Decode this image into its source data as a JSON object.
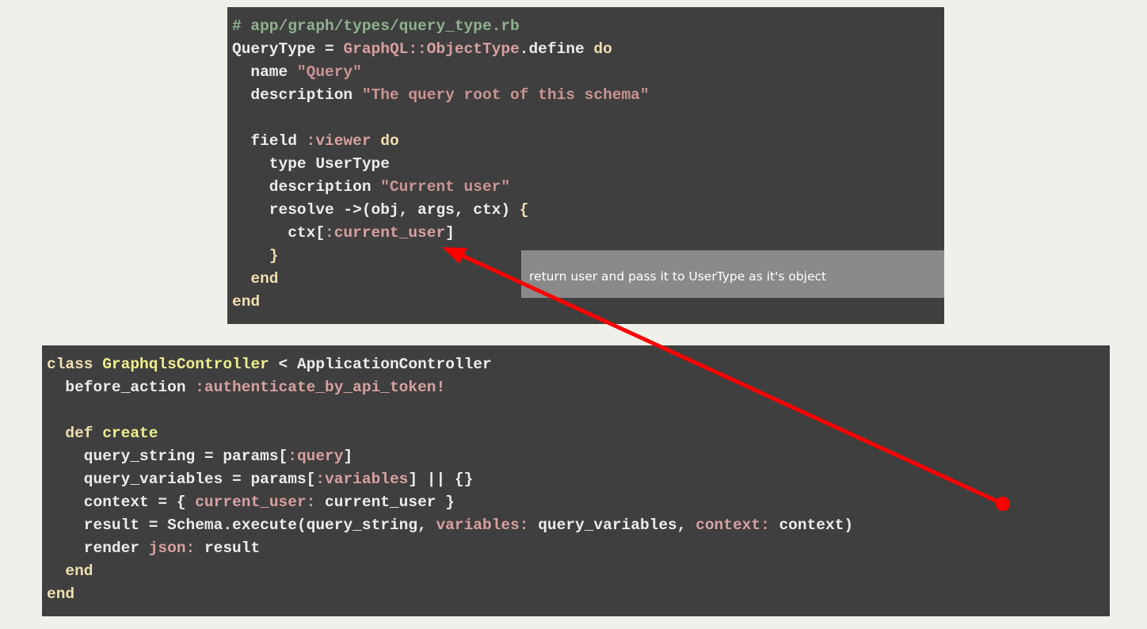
{
  "top_code": {
    "lines": [
      [
        {
          "t": "# app/graph/types/query_type.rb",
          "c": "cm"
        }
      ],
      [
        {
          "t": "QueryType = ",
          "c": ""
        },
        {
          "t": "GraphQL::ObjectType",
          "c": "sy"
        },
        {
          "t": ".define ",
          "c": ""
        },
        {
          "t": "do",
          "c": "kw"
        }
      ],
      [
        {
          "t": "  name ",
          "c": ""
        },
        {
          "t": "\"Query\"",
          "c": "st"
        }
      ],
      [
        {
          "t": "  description ",
          "c": ""
        },
        {
          "t": "\"The query root of this schema\"",
          "c": "st"
        }
      ],
      [
        {
          "t": "",
          "c": ""
        }
      ],
      [
        {
          "t": "  field ",
          "c": ""
        },
        {
          "t": ":viewer",
          "c": "sy"
        },
        {
          "t": " ",
          "c": ""
        },
        {
          "t": "do",
          "c": "kw"
        }
      ],
      [
        {
          "t": "    type UserType",
          "c": ""
        }
      ],
      [
        {
          "t": "    description ",
          "c": ""
        },
        {
          "t": "\"Current user\"",
          "c": "st"
        }
      ],
      [
        {
          "t": "    resolve ->(obj, args, ctx) ",
          "c": ""
        },
        {
          "t": "{",
          "c": "kw"
        }
      ],
      [
        {
          "t": "      ctx[",
          "c": ""
        },
        {
          "t": ":current_user",
          "c": "sy"
        },
        {
          "t": "]",
          "c": ""
        }
      ],
      [
        {
          "t": "    }",
          "c": "kw"
        }
      ],
      [
        {
          "t": "  end",
          "c": "kw"
        }
      ],
      [
        {
          "t": "end",
          "c": "kw"
        }
      ]
    ]
  },
  "bottom_code": {
    "lines": [
      [
        {
          "t": "class ",
          "c": "kw"
        },
        {
          "t": "GraphqlsController",
          "c": "cn"
        },
        {
          "t": " < ApplicationController",
          "c": ""
        }
      ],
      [
        {
          "t": "  before_action ",
          "c": ""
        },
        {
          "t": ":authenticate_by_api_token!",
          "c": "sy"
        }
      ],
      [
        {
          "t": "",
          "c": ""
        }
      ],
      [
        {
          "t": "  def ",
          "c": "kw"
        },
        {
          "t": "create",
          "c": "cn"
        }
      ],
      [
        {
          "t": "    query_string = params[",
          "c": ""
        },
        {
          "t": ":query",
          "c": "sy"
        },
        {
          "t": "]",
          "c": ""
        }
      ],
      [
        {
          "t": "    query_variables = params[",
          "c": ""
        },
        {
          "t": ":variables",
          "c": "sy"
        },
        {
          "t": "] || {}",
          "c": ""
        }
      ],
      [
        {
          "t": "    context = { ",
          "c": ""
        },
        {
          "t": "current_user:",
          "c": "sy"
        },
        {
          "t": " current_user }",
          "c": ""
        }
      ],
      [
        {
          "t": "    result = Schema.execute(query_string, ",
          "c": ""
        },
        {
          "t": "variables:",
          "c": "sy"
        },
        {
          "t": " query_variables, ",
          "c": ""
        },
        {
          "t": "context:",
          "c": "sy"
        },
        {
          "t": " context)",
          "c": ""
        }
      ],
      [
        {
          "t": "    render ",
          "c": ""
        },
        {
          "t": "json:",
          "c": "sy"
        },
        {
          "t": " result",
          "c": ""
        }
      ],
      [
        {
          "t": "  end",
          "c": "kw"
        }
      ],
      [
        {
          "t": "end",
          "c": "kw"
        }
      ]
    ]
  },
  "annotation": {
    "text": "return user and pass it to UserType as it's object",
    "arrow_color": "#ff0000"
  }
}
